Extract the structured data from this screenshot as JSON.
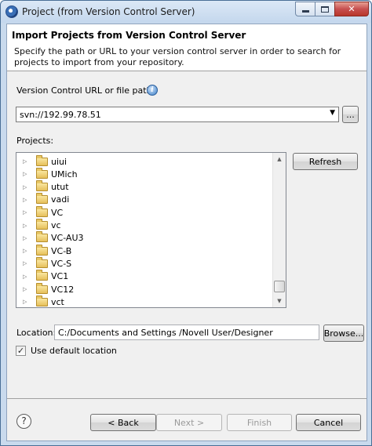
{
  "window": {
    "title": "Project (from Version Control Server)"
  },
  "header": {
    "title": "Import Projects from Version Control Server",
    "description": "Specify the path or URL to your version control server in order to search for projects to import from your repository."
  },
  "url_field": {
    "label": "Version Control URL or file path:",
    "value": "svn://192.99.78.51",
    "browse_label": "..."
  },
  "projects": {
    "label": "Projects:",
    "items": [
      "uiui",
      "UMich",
      "utut",
      "vadi",
      "VC",
      "vc",
      "VC-AU3",
      "VC-B",
      "VC-S",
      "VC1",
      "VC12",
      "vct"
    ],
    "refresh_label": "Refresh"
  },
  "location": {
    "label": "Location:",
    "value": "C:/Documents and Settings /Novell User/Designer",
    "browse_label": "Browse..."
  },
  "default_location": {
    "label": "Use default location",
    "checked": true
  },
  "buttons": {
    "help": "?",
    "back": "< Back",
    "next": "Next >",
    "finish": "Finish",
    "cancel": "Cancel"
  },
  "icons": {
    "app": "eclipse-icon",
    "info": "info-icon",
    "folder": "folder-icon",
    "help": "help-icon"
  },
  "colors": {
    "title_bar": "#c4d7ed",
    "close_button": "#c75050",
    "dialog_bg": "#f0f0f0",
    "header_bg": "#ffffff"
  }
}
